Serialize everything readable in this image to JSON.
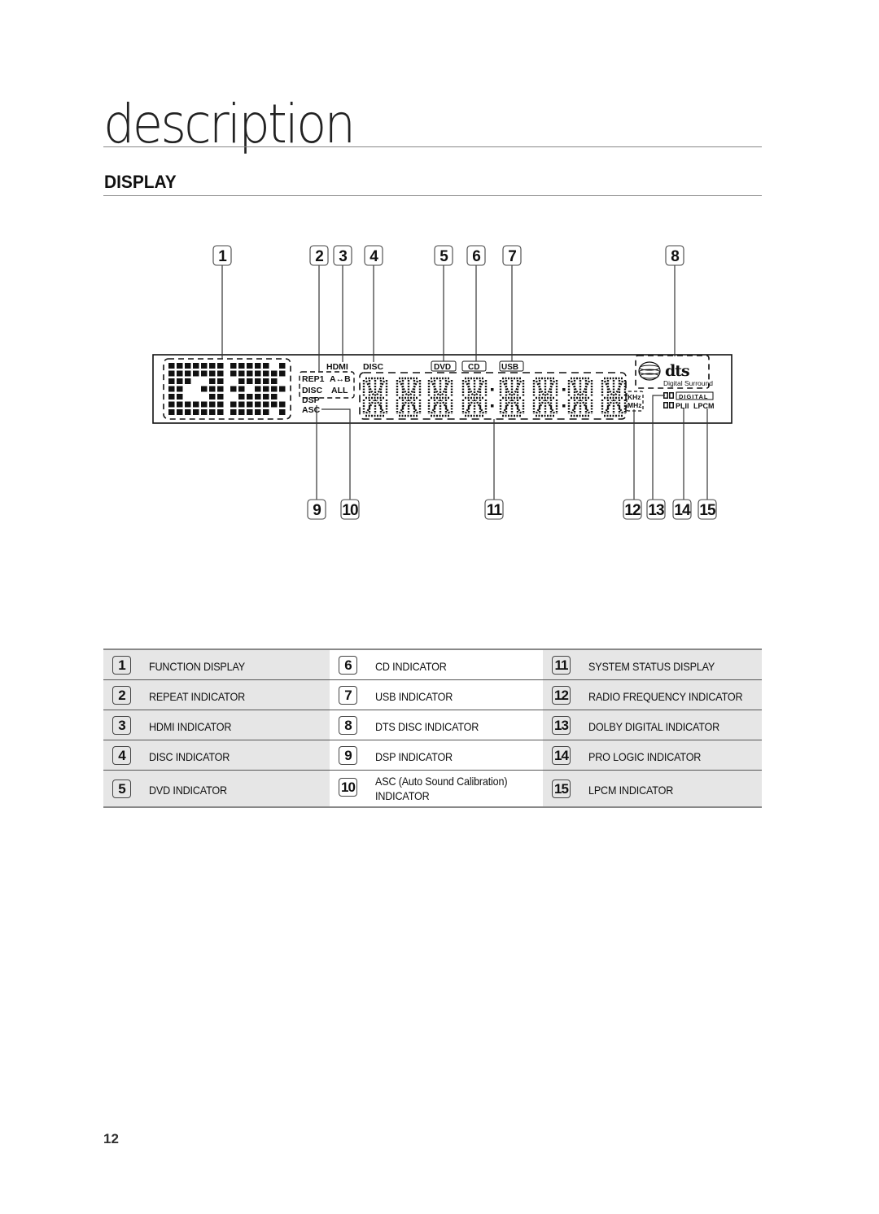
{
  "page": {
    "section_title": "description",
    "subtitle": "DISPLAY",
    "page_number": "12"
  },
  "diagram": {
    "callouts_top": [
      "1",
      "2",
      "3",
      "4",
      "5",
      "6",
      "7",
      "8"
    ],
    "callouts_bottom": [
      "9",
      "10",
      "11",
      "12",
      "13",
      "14",
      "15"
    ],
    "panel_labels": {
      "hdmi": "HDMI",
      "disc": "DISC",
      "rep1": "REP1",
      "a_b": "A↔B",
      "disc_small": "DISC",
      "all": "ALL",
      "dsp": "DSP",
      "asc": "ASC",
      "dvd": "DVD",
      "cd": "CD",
      "usb": "USB",
      "khz": "KHz",
      "mhz": "MHz",
      "dts": "dts",
      "digital_surround": "Digital Surround",
      "digital": "DIGITAL",
      "plii": "PLII",
      "lpcm": "LPCM"
    }
  },
  "legend": {
    "rows": [
      [
        {
          "num": "1",
          "label": "FUNCTION DISPLAY"
        },
        {
          "num": "6",
          "label": "CD INDICATOR"
        },
        {
          "num": "11",
          "label": "SYSTEM STATUS DISPLAY"
        }
      ],
      [
        {
          "num": "2",
          "label": "REPEAT INDICATOR"
        },
        {
          "num": "7",
          "label": "USB INDICATOR"
        },
        {
          "num": "12",
          "label": "RADIO FREQUENCY INDICATOR"
        }
      ],
      [
        {
          "num": "3",
          "label": "HDMI INDICATOR"
        },
        {
          "num": "8",
          "label": "DTS DISC INDICATOR"
        },
        {
          "num": "13",
          "label": "DOLBY DIGITAL INDICATOR"
        }
      ],
      [
        {
          "num": "4",
          "label": "DISC INDICATOR"
        },
        {
          "num": "9",
          "label": "DSP INDICATOR"
        },
        {
          "num": "14",
          "label": "PRO LOGIC INDICATOR"
        }
      ],
      [
        {
          "num": "5",
          "label": "DVD INDICATOR"
        },
        {
          "num": "10",
          "label": "ASC (Auto Sound Calibration)",
          "label2": "INDICATOR"
        },
        {
          "num": "15",
          "label": "LPCM INDICATOR"
        }
      ]
    ]
  }
}
